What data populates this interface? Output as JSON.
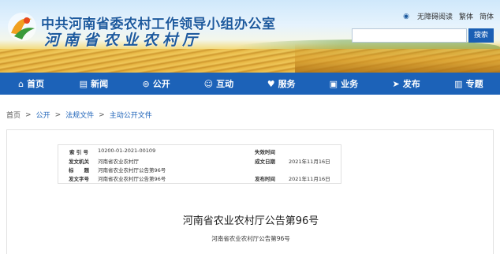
{
  "header": {
    "title_line1": "中共河南省委农村工作领导小组办公室",
    "title_line2": "河南省农业农村厅",
    "toplinks": [
      "无障碍阅读",
      "繁体",
      "简体"
    ],
    "search_placeholder": "",
    "search_button": "搜索"
  },
  "nav": {
    "items": [
      {
        "icon": "⌂",
        "label": "首页"
      },
      {
        "icon": "▤",
        "label": "新闻"
      },
      {
        "icon": "⊚",
        "label": "公开"
      },
      {
        "icon": "☺",
        "label": "互动"
      },
      {
        "icon": "♥",
        "label": "服务"
      },
      {
        "icon": "▣",
        "label": "业务"
      },
      {
        "icon": "➤",
        "label": "发布"
      },
      {
        "icon": "▥",
        "label": "专题"
      }
    ]
  },
  "breadcrumb": [
    "首页",
    "公开",
    "法规文件",
    "主动公开文件"
  ],
  "info": {
    "rows": [
      {
        "k1": "索 引 号",
        "v1": "10200-01-2021-00109",
        "k2": "失效时间",
        "v2": ""
      },
      {
        "k1": "发文机关",
        "v1": "河南省农业农村厅",
        "k2": "成文日期",
        "v2": "2021年11月16日"
      },
      {
        "k1": "标　　题",
        "v1": "河南省农业农村厅公告第96号",
        "k2": "",
        "v2": ""
      },
      {
        "k1": "发文字号",
        "v1": "河南省农业农村厅公告第96号",
        "k2": "发布时间",
        "v2": "2021年11月16日"
      }
    ]
  },
  "document": {
    "title": "河南省农业农村厅公告第96号",
    "subtitle": "河南省农业农村厅公告第96号"
  },
  "colors": {
    "nav_bg": "#1c62b8",
    "title_blue": "#1d5a9e",
    "search_button_bg": "#1a5fb4"
  }
}
